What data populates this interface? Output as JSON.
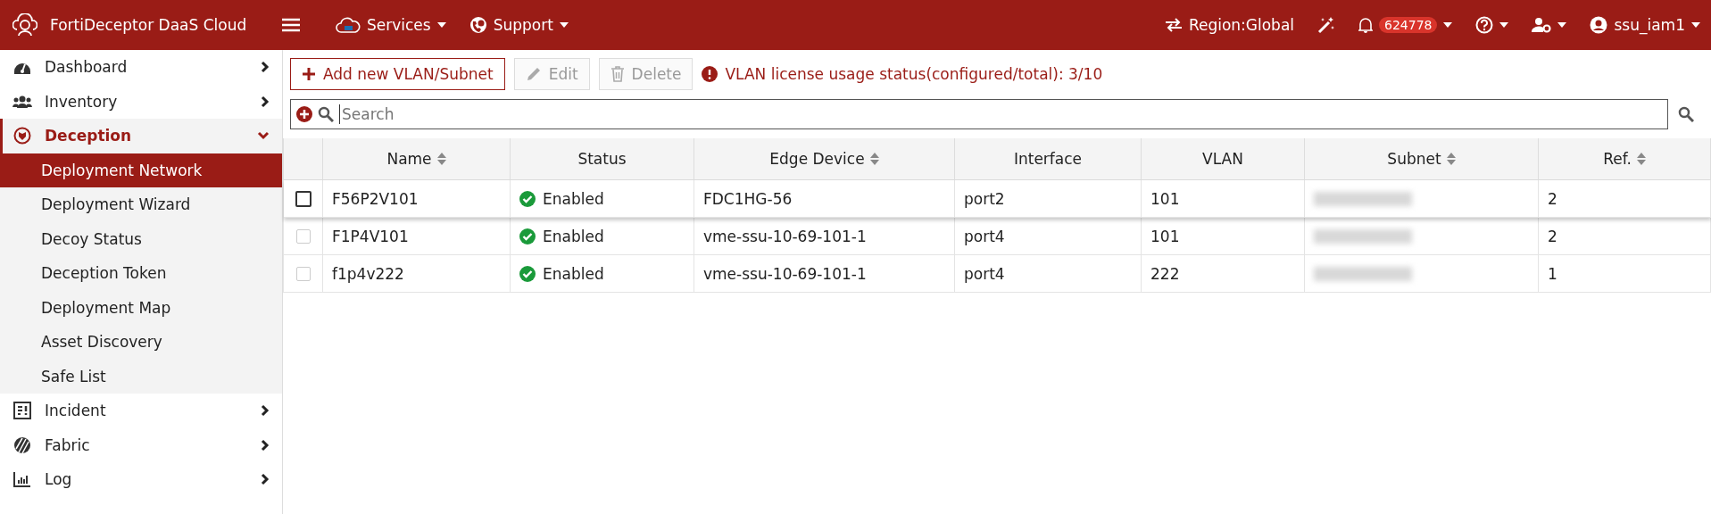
{
  "header": {
    "title": "FortiDeceptor DaaS Cloud",
    "menus": [
      {
        "label": "Services",
        "kind": "cloud"
      },
      {
        "label": "Support",
        "kind": "support"
      }
    ],
    "region": "Region:Global",
    "notifications": "624778",
    "user": "ssu_iam1"
  },
  "sidebar": {
    "items": [
      {
        "label": "Dashboard",
        "kind": "dashboard",
        "expanded": false,
        "selected": false
      },
      {
        "label": "Inventory",
        "kind": "users",
        "expanded": false,
        "selected": false
      },
      {
        "label": "Deception",
        "kind": "deception",
        "expanded": true,
        "selected": true,
        "children": [
          {
            "label": "Deployment Network",
            "selected": true
          },
          {
            "label": "Deployment Wizard",
            "selected": false
          },
          {
            "label": "Decoy Status",
            "selected": false
          },
          {
            "label": "Deception Token",
            "selected": false
          },
          {
            "label": "Deployment Map",
            "selected": false
          },
          {
            "label": "Asset Discovery",
            "selected": false
          },
          {
            "label": "Safe List",
            "selected": false
          }
        ]
      },
      {
        "label": "Incident",
        "kind": "incident",
        "expanded": false,
        "selected": false
      },
      {
        "label": "Fabric",
        "kind": "fabric",
        "expanded": false,
        "selected": false
      },
      {
        "label": "Log",
        "kind": "log",
        "expanded": false,
        "selected": false
      }
    ]
  },
  "toolbar": {
    "buttons": [
      {
        "label": "Add new VLAN/Subnet",
        "kind": "add",
        "disabled": false
      },
      {
        "label": "Edit",
        "kind": "edit",
        "disabled": true
      },
      {
        "label": "Delete",
        "kind": "delete",
        "disabled": true
      }
    ],
    "license_status": "VLAN license usage status(configured/total): 3/10"
  },
  "search": {
    "placeholder": "Search"
  },
  "table": {
    "columns": [
      {
        "label": "Name",
        "sortable": true
      },
      {
        "label": "Status",
        "sortable": false
      },
      {
        "label": "Edge Device",
        "sortable": true
      },
      {
        "label": "Interface",
        "sortable": false
      },
      {
        "label": "VLAN",
        "sortable": false
      },
      {
        "label": "Subnet",
        "sortable": true
      },
      {
        "label": "Ref.",
        "sortable": true
      }
    ],
    "rows": [
      {
        "checked": false,
        "hovered": true,
        "name": "F56P2V101",
        "status": "Enabled",
        "edge_device": "FDC1HG-56",
        "interface": "port2",
        "vlan": "101",
        "ref": "2"
      },
      {
        "checked": false,
        "hovered": false,
        "name": "F1P4V101",
        "status": "Enabled",
        "edge_device": "vme-ssu-10-69-101-1",
        "interface": "port4",
        "vlan": "101",
        "ref": "2"
      },
      {
        "checked": false,
        "hovered": false,
        "name": "f1p4v222",
        "status": "Enabled",
        "edge_device": "vme-ssu-10-69-101-1",
        "interface": "port4",
        "vlan": "222",
        "ref": "1"
      }
    ]
  }
}
